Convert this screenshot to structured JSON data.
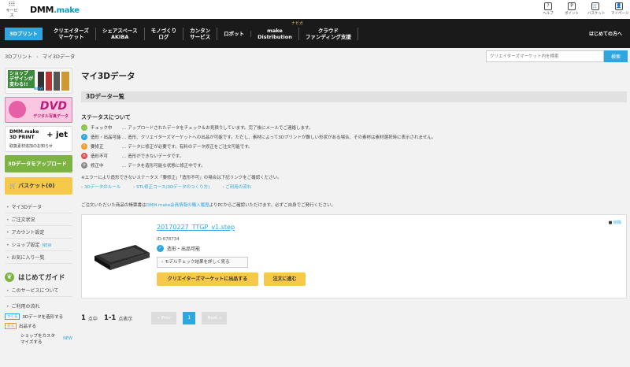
{
  "header": {
    "menu_label": "サービス",
    "logo_main": "DMM",
    "logo_sub": ".make",
    "icons": [
      {
        "name": "help",
        "label": "ヘルプ",
        "glyph": "?"
      },
      {
        "name": "points",
        "label": "ポイント",
        "glyph": "P"
      },
      {
        "name": "basket",
        "label": "バスケット",
        "glyph": "🛒"
      },
      {
        "name": "mypage",
        "label": "マイページ",
        "glyph": "👤"
      }
    ]
  },
  "nav": {
    "items": [
      {
        "label": "3Dプリント"
      },
      {
        "label": "クリエイターズ\nマーケット"
      },
      {
        "label": "シェアスペース\nAKIBA"
      },
      {
        "label": "モノづくり\nログ"
      },
      {
        "label": "カンタン\nサービス"
      },
      {
        "label": "ロボット"
      },
      {
        "label": "make\nDistribution"
      },
      {
        "label": "クラウド\nファンディング支援"
      }
    ],
    "hint": "ナビガ",
    "right": "はじめての方へ"
  },
  "breadcrumb": [
    "3Dプリント",
    "マイ3Dデータ"
  ],
  "search": {
    "placeholder": "クリエイターズマーケット内を検索",
    "button": "検索"
  },
  "sidebar": {
    "banner1": "ショップ\nデザインが\n変わる!!",
    "banner1_new": "NEW",
    "banner2": "DVD",
    "banner2_sub": "デジタル写真データ",
    "banner3_title": "DMM.make\n3D PRINT",
    "banner3_jet": "+ jet",
    "banner3_sub": "取扱素材追加のお知らせ",
    "upload": "3Dデータをアップロード",
    "basket": "バスケット(0)",
    "links": [
      {
        "label": "マイ3Dデータ"
      },
      {
        "label": "ご注文状況"
      },
      {
        "label": "アカウント設定"
      },
      {
        "label": "ショップ設定",
        "badge": "NEW"
      },
      {
        "label": "お気に入り一覧"
      }
    ],
    "guide": "はじめてガイド",
    "guide_link": "このサービスについて",
    "flow_title": "ご利用の流れ",
    "flow": [
      {
        "tag": "つくる",
        "label": "3Dデータを造形する"
      },
      {
        "tag": "売る",
        "label": "出品する"
      },
      {
        "tag": "",
        "label": "ショップをカスタマイズする",
        "badge": "NEW"
      }
    ]
  },
  "main": {
    "title": "マイ3Dデータ",
    "section": "3Dデータ一覧",
    "status_head": "ステータスについて",
    "statuses": [
      {
        "name": "チェック中",
        "icon": "…",
        "color": "#8bc34a",
        "desc": "… アップロードされたデータをチェック＆お見積りしています。完了後にメールでご連絡します。"
      },
      {
        "name": "造形・出品可能",
        "icon": "✓",
        "color": "#2ea7e0",
        "desc": "… 造形、クリエイターズマーケットへの出品が可能です。ただし、素材によって3Dプリントが難しい形状がある場合、その素材は素材選択時に表示されません。"
      },
      {
        "name": "要修正",
        "icon": "!",
        "color": "#f0a030",
        "desc": "… データに修正が必要です。有料のデータ修正をご注文可能です。"
      },
      {
        "name": "造形不可",
        "icon": "×",
        "color": "#e05050",
        "desc": "… 造形ができないデータです。"
      },
      {
        "name": "修正中",
        "icon": "⟳",
        "color": "#888888",
        "desc": "… データを造形可能な状態に修正中です。"
      }
    ],
    "note": "※エラーにより造形できないステータス「要修正」「造形不可」の場合は下記リンクをご確認ください。",
    "links": [
      "3Dデータのルール",
      "STL修正コース(3Dデータのつくり方)",
      "ご利用の流れ"
    ],
    "warning_pre": "ご注文いただいた商品の帳票書は",
    "warning_link": "DMM.make会員情報の購入履歴",
    "warning_post": "よりPCからご確認いただけます。必ずご自身でご発行ください。",
    "card": {
      "flag": "削除",
      "filename": "20170227_TTGP_v1.step",
      "id": "ID:678734",
      "status": "造形・出品可能",
      "detail_btn": "モデルチェック結果を詳しく見る",
      "creator_btn": "クリエイターズマーケットに出品する",
      "order_btn": "注文に進む"
    },
    "pager": {
      "total": "1",
      "total_suffix": "点中",
      "range": "1-1",
      "range_suffix": "点表示",
      "prev": "« Prev",
      "page": "1",
      "next": "Next »"
    }
  }
}
